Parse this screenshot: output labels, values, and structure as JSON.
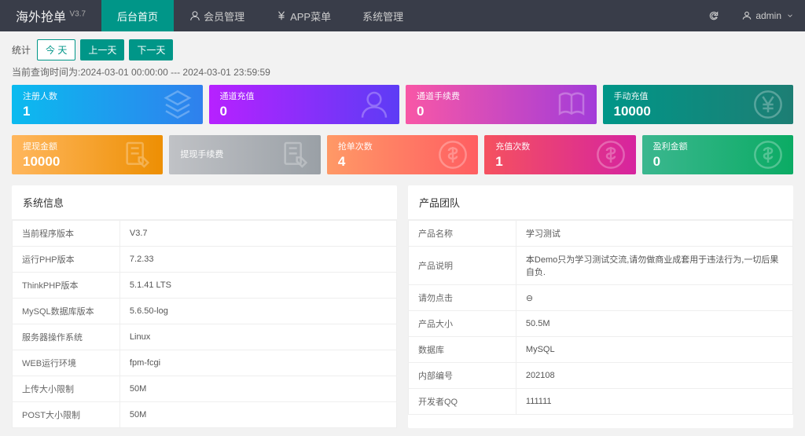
{
  "header": {
    "logo": "海外抢单",
    "version": "V3.7",
    "nav": [
      {
        "label": "后台首页",
        "active": true,
        "icon": null
      },
      {
        "label": "会员管理",
        "active": false,
        "icon": "user"
      },
      {
        "label": "APP菜单",
        "active": false,
        "icon": "yen"
      },
      {
        "label": "系统管理",
        "active": false,
        "icon": null
      }
    ],
    "refresh_icon": "refresh",
    "user_icon": "user",
    "username": "admin"
  },
  "filter": {
    "label": "统计",
    "buttons": [
      "今 天",
      "上一天",
      "下一天"
    ],
    "active_index": 0,
    "time_note": "当前查询时间为:2024-03-01 00:00:00 --- 2024-03-01 23:59:59"
  },
  "stats_row1": [
    {
      "label": "注册人数",
      "value": "1",
      "gradient": "g-blue",
      "icon": "layers"
    },
    {
      "label": "通道充值",
      "value": "0",
      "gradient": "g-purple",
      "icon": "user"
    },
    {
      "label": "通道手续费",
      "value": "0",
      "gradient": "g-pink",
      "icon": "book"
    },
    {
      "label": "手动充值",
      "value": "10000",
      "gradient": "g-teal",
      "icon": "yen-circle"
    }
  ],
  "stats_row2": [
    {
      "label": "提现金额",
      "value": "10000",
      "gradient": "g-orange",
      "icon": "edit"
    },
    {
      "label": "提现手续费",
      "value": "",
      "gradient": "g-gray",
      "icon": "edit"
    },
    {
      "label": "抢单次数",
      "value": "4",
      "gradient": "g-redor",
      "icon": "dollar"
    },
    {
      "label": "充值次数",
      "value": "1",
      "gradient": "g-redpk",
      "icon": "dollar"
    },
    {
      "label": "盈利金额",
      "value": "0",
      "gradient": "g-green",
      "icon": "dollar"
    }
  ],
  "panel_sys": {
    "title": "系统信息",
    "rows": [
      {
        "k": "当前程序版本",
        "v": "V3.7"
      },
      {
        "k": "运行PHP版本",
        "v": "7.2.33"
      },
      {
        "k": "ThinkPHP版本",
        "v": "5.1.41 LTS"
      },
      {
        "k": "MySQL数据库版本",
        "v": "5.6.50-log"
      },
      {
        "k": "服务器操作系统",
        "v": "Linux"
      },
      {
        "k": "WEB运行环境",
        "v": "fpm-fcgi"
      },
      {
        "k": "上传大小限制",
        "v": "50M"
      },
      {
        "k": "POST大小限制",
        "v": "50M"
      }
    ]
  },
  "panel_team": {
    "title": "产品团队",
    "rows": [
      {
        "k": "产品名称",
        "v": "学习测试"
      },
      {
        "k": "产品说明",
        "v": "本Demo只为学习测试交流,请勿做商业成套用于违法行为,一切后果自负."
      },
      {
        "k": "请勿点击",
        "v": "⊖"
      },
      {
        "k": "产品大小",
        "v": "50.5M"
      },
      {
        "k": "数据库",
        "v": "MySQL"
      },
      {
        "k": "内部编号",
        "v": "202108"
      },
      {
        "k": "开发者QQ",
        "v": "111111"
      }
    ]
  }
}
